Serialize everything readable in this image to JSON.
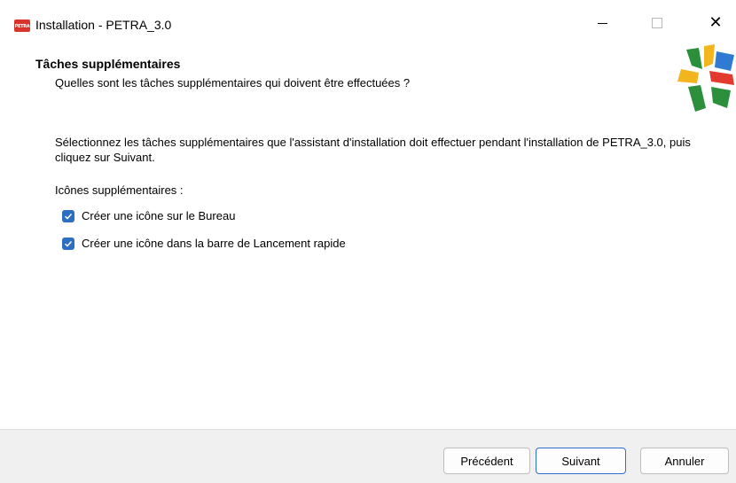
{
  "window": {
    "app_icon_text": "PETRA",
    "title": "Installation - PETRA_3.0"
  },
  "header": {
    "title": "Tâches supplémentaires",
    "subtitle": "Quelles sont les tâches supplémentaires qui doivent être effectuées ?"
  },
  "content": {
    "description": "Sélectionnez les tâches supplémentaires que l'assistant d'installation doit effectuer pendant l'installation de PETRA_3.0, puis cliquez sur Suivant.",
    "group_label": "Icônes supplémentaires :",
    "options": [
      {
        "label": "Créer une icône sur le Bureau",
        "checked": true
      },
      {
        "label": "Créer une icône dans la barre de Lancement rapide",
        "checked": true
      }
    ]
  },
  "footer": {
    "prev_label": "Précédent",
    "next_label": "Suivant",
    "cancel_label": "Annuler"
  },
  "colors": {
    "checkbox_accent": "#2c6ec0",
    "app_icon_red": "#d9342b",
    "footer_bg": "#f0f0f0"
  }
}
